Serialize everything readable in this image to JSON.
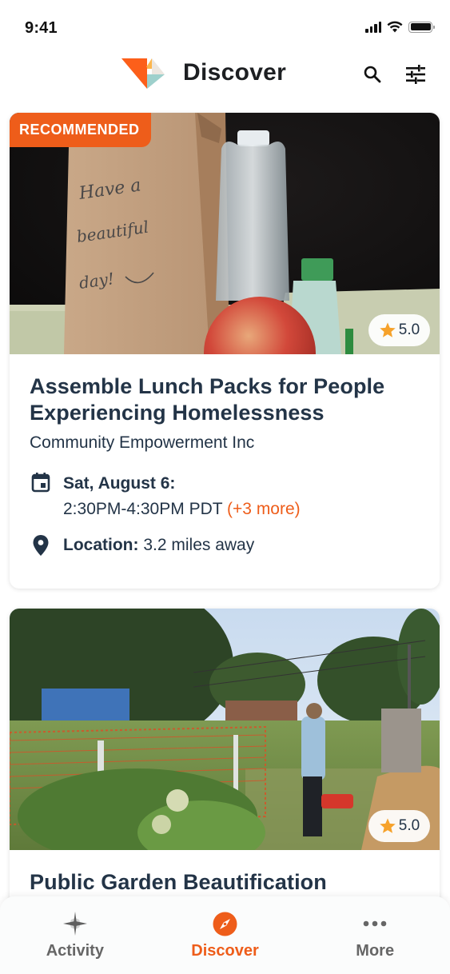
{
  "status_bar": {
    "time": "9:41"
  },
  "header": {
    "title": "Discover",
    "search_icon": "search-icon",
    "filter_icon": "tune-sliders-icon"
  },
  "colors": {
    "accent": "#ee5d1a",
    "text_primary": "#233447",
    "tab_inactive": "#666666",
    "logo_orange": "#fc5f1a",
    "logo_teal": "#9ed0cc",
    "logo_yellow": "#fcb64d",
    "logo_cream": "#ece6df",
    "star": "#f6a22b"
  },
  "cards": [
    {
      "badge": "RECOMMENDED",
      "rating": "5.0",
      "image_alt": "Brown paper lunch bag reading 'Have a beautiful day!' with water bottle, apple and hand sanitizer",
      "title": "Assemble Lunch Packs for People Experiencing Homelessness",
      "organization": "Community Empowerment Inc",
      "date_label": "Sat, August 6:",
      "time_range": "2:30PM-4:30PM PDT",
      "more_dates": "(+3 more)",
      "location_label": "Location:",
      "location_value": "3.2 miles away"
    },
    {
      "rating": "5.0",
      "image_alt": "Volunteers working in a community garden with orange fencing",
      "title": "Public Garden Beautification"
    }
  ],
  "tab_bar": {
    "tabs": [
      {
        "label": "Activity",
        "icon": "sparkle-icon",
        "active": false
      },
      {
        "label": "Discover",
        "icon": "compass-icon",
        "active": true
      },
      {
        "label": "More",
        "icon": "more-dots-icon",
        "active": false
      }
    ]
  }
}
